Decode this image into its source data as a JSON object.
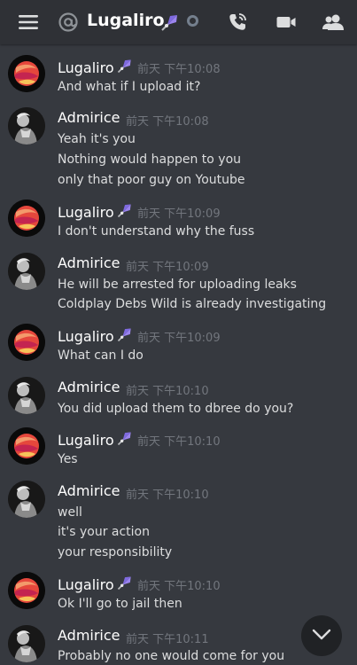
{
  "header": {
    "title": "Lugaliro",
    "icons": {
      "menu": "hamburger-menu-icon",
      "mention": "at-sign-icon",
      "badge": "satellite-icon",
      "status": "offline-status-icon",
      "call": "phone-call-icon",
      "video": "video-camera-icon",
      "members": "members-icon"
    }
  },
  "messages": [
    {
      "author": "Lugaliro",
      "timestamp": "前天 下午10:08",
      "lines": [
        "And what if I upload it?"
      ]
    },
    {
      "author": "Admirice",
      "timestamp": "前天 下午10:08",
      "lines": [
        "Yeah it's you",
        "Nothing would happen to you",
        "only that poor guy on Youtube"
      ]
    },
    {
      "author": "Lugaliro",
      "timestamp": "前天 下午10:09",
      "lines": [
        "I don't understand why the fuss"
      ]
    },
    {
      "author": "Admirice",
      "timestamp": "前天 下午10:09",
      "lines": [
        "He will be arrested for uploading leaks",
        "Coldplay Debs Wild is already investigating"
      ]
    },
    {
      "author": "Lugaliro",
      "timestamp": "前天 下午10:09",
      "lines": [
        "What can I do"
      ]
    },
    {
      "author": "Admirice",
      "timestamp": "前天 下午10:10",
      "lines": [
        "You did upload them to dbree do you?"
      ]
    },
    {
      "author": "Lugaliro",
      "timestamp": "前天 下午10:10",
      "lines": [
        "Yes"
      ]
    },
    {
      "author": "Admirice",
      "timestamp": "前天 下午10:10",
      "lines": [
        "well",
        "it's your action",
        "your responsibility"
      ]
    },
    {
      "author": "Lugaliro",
      "timestamp": "前天 下午10:10",
      "lines": [
        "Ok I'll go to jail then"
      ]
    },
    {
      "author": "Admirice",
      "timestamp": "前天 下午10:11",
      "lines": [
        "Probably no one would come for you"
      ]
    }
  ],
  "colors": {
    "background": "#36393f",
    "header": "#2f3136",
    "timestamp": "#72767d",
    "text": "#dcddde",
    "username": "#ffffff",
    "badge": "#9b84ee"
  }
}
